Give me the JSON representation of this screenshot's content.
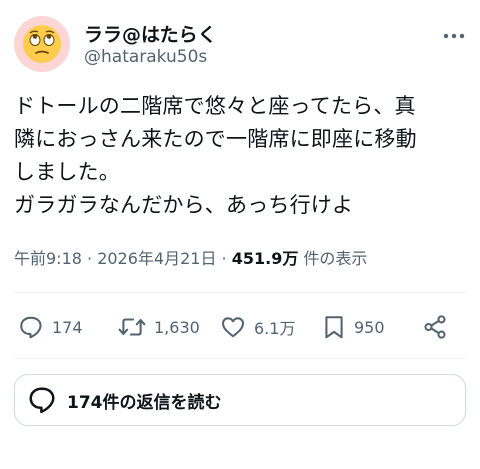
{
  "author": {
    "display_name": "ララ@はたらく",
    "handle": "@hataraku50s",
    "avatar_icon": "rolling-eyes-emoji-icon",
    "avatar_bg": "#fbd6d4"
  },
  "more_icon": "more-dots-icon",
  "tweet": {
    "lines": [
      "ドトールの二階席で悠々と座ってたら、真",
      "隣におっさん来たので一階席に即座に移動",
      "しました。",
      "ガラガラなんだから、あっち行けよ"
    ]
  },
  "meta": {
    "timestamp": "午前9:18 · 2026年4月21日 · ",
    "views_count": "451.9万",
    "views_label": " 件の表示"
  },
  "actions": {
    "reply": {
      "icon": "reply-icon",
      "count": "174"
    },
    "retweet": {
      "icon": "retweet-icon",
      "count": "1,630"
    },
    "like": {
      "icon": "heart-icon",
      "count": "6.1万"
    },
    "bookmark": {
      "icon": "bookmark-icon",
      "count": "950"
    },
    "share": {
      "icon": "share-icon"
    }
  },
  "replies_button": {
    "icon": "chat-bubble-icon",
    "label": "174件の返信を読む"
  },
  "colors": {
    "text": "#0f1419",
    "secondary": "#536471",
    "divider": "#eff3f4",
    "border": "#cfd9de"
  }
}
